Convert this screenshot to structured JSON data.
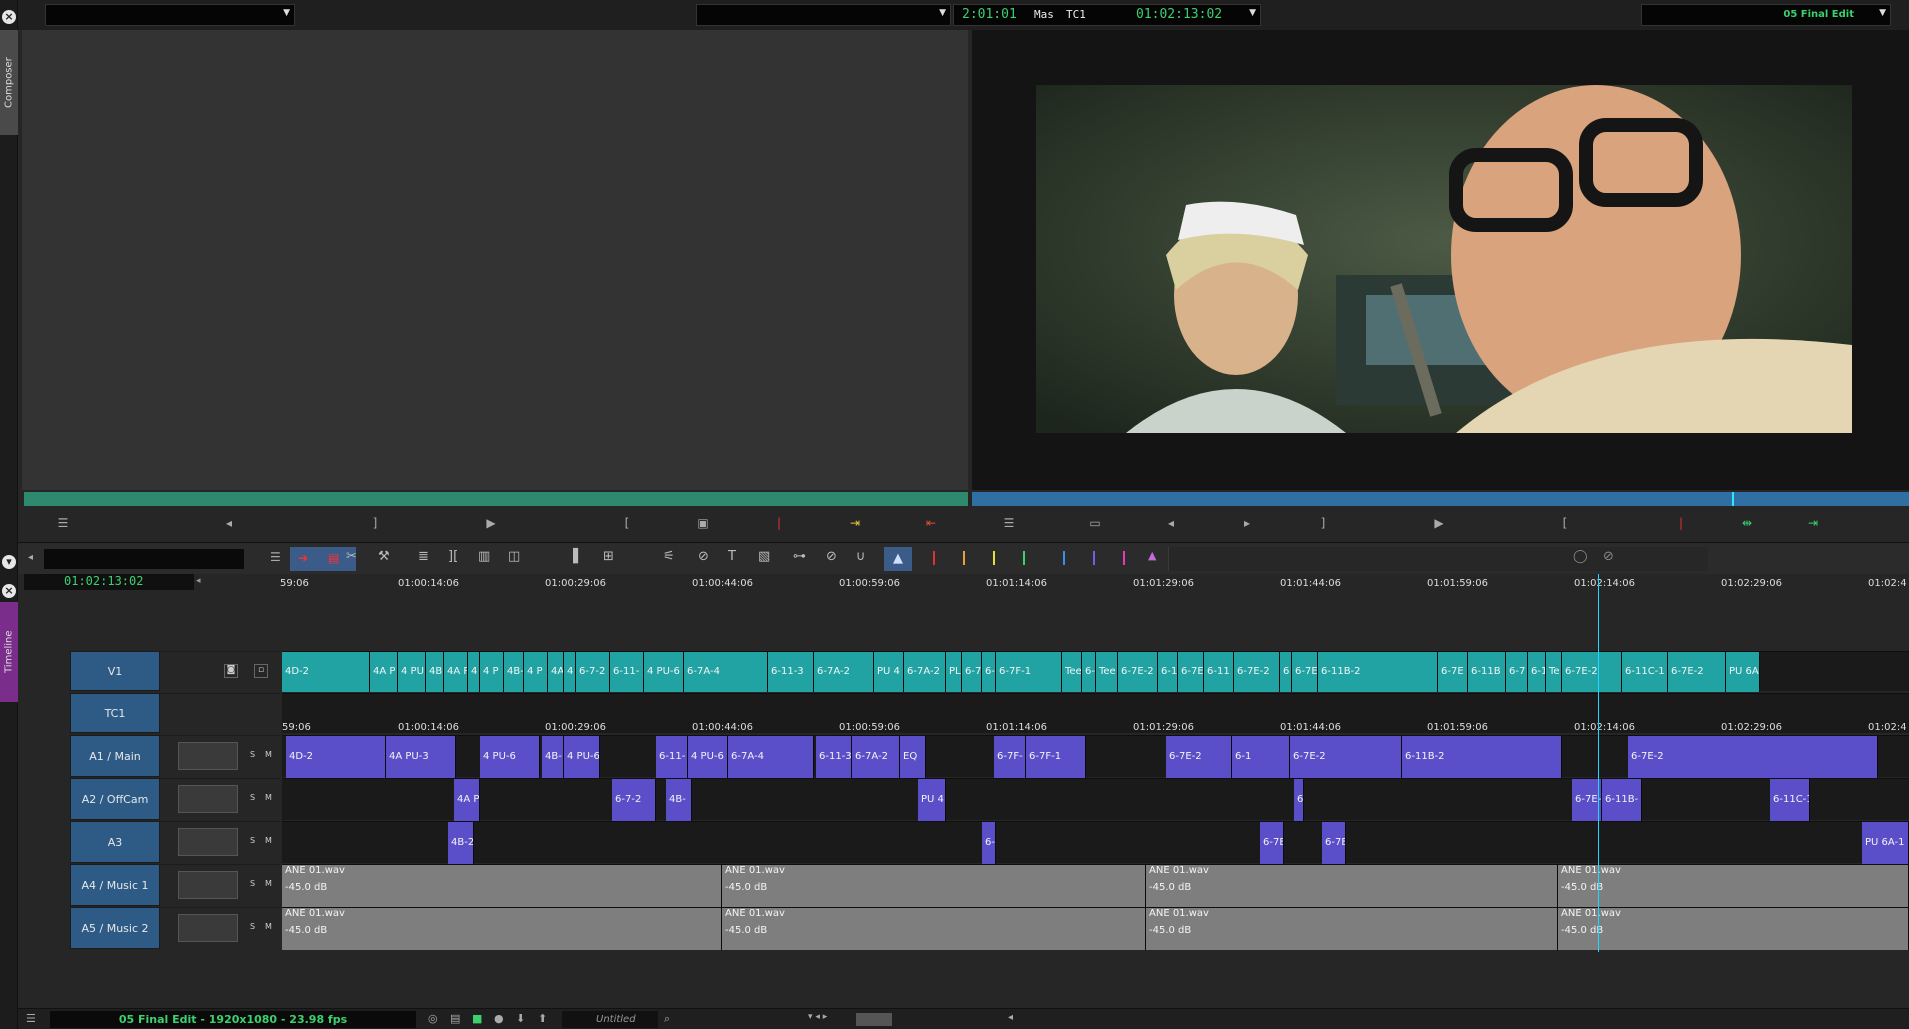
{
  "side": {
    "composer_label": "Composer",
    "timeline_label": "Timeline"
  },
  "topbar": {
    "source_dropdown_value": "",
    "record_dropdown_value": "",
    "duration_tc": "2:01:01",
    "track_label": "Mas",
    "tc_label": "TC1",
    "record_tc": "01:02:13:02",
    "sequence_name": "05 Final Edit"
  },
  "timeline": {
    "current_tc": "01:02:13:02",
    "ruler_ticks": [
      "59:06",
      "01:00:14:06",
      "01:00:29:06",
      "01:00:44:06",
      "01:00:59:06",
      "01:01:14:06",
      "01:01:29:06",
      "01:01:44:06",
      "01:01:59:06",
      "01:02:14:06",
      "01:02:29:06",
      "01:02:4"
    ],
    "tracks": [
      {
        "name": "V1"
      },
      {
        "name": "TC1"
      },
      {
        "name": "A1 / Main"
      },
      {
        "name": "A2 / OffCam"
      },
      {
        "name": "A3"
      },
      {
        "name": "A4 / Music 1"
      },
      {
        "name": "A5 / Music 2"
      }
    ],
    "v1_clips": [
      "4D-2",
      "4A P",
      "4 PU",
      "4B",
      "4A P",
      "4",
      "4 P",
      "4B-",
      "4 P",
      "4A",
      "4",
      "6-7-2",
      "6-11-",
      "4 PU-6",
      "6-7A-4",
      "6-11-3",
      "6-7A-2",
      "PU 4",
      "6-7A-2",
      "PL",
      "6-7",
      "6-1",
      "6-7F-1",
      "Tee",
      "6-",
      "Tee",
      "6-7E-2",
      "6-1",
      "6-7E",
      "6-11",
      "6-7E-2",
      "6",
      "6-7E",
      "6-11B-2",
      "6-7E",
      "6-11B",
      "6-7",
      "6-1",
      "Te",
      "6-7E-2",
      "6-11C-1",
      "6-7E-2",
      "PU 6A"
    ],
    "a1_clips": [
      "4D-2",
      "4A PU-3",
      "4 PU-6",
      "4B-",
      "4 PU-6",
      "6-11-",
      "4 PU-6",
      "6-7A-4",
      "6-11-3",
      "6-7A-2",
      "EQ",
      "6-7F-",
      "6-7F-1",
      "6-7E-2",
      "6-1",
      "6-7E-2",
      "6-11B-2",
      "6-7E-2"
    ],
    "a2_clips": [
      "4A P",
      "6-7-2",
      "4B-",
      "PU 4",
      "6-",
      "6-7E-2",
      "6-11B-",
      "6-11C-1"
    ],
    "a3_clips": [
      "4B-2",
      "6-",
      "6-7E",
      "6-7E",
      "PU 6A-1"
    ],
    "music_clip_name": "ANE 01.wav",
    "music_level": "-45.0 dB",
    "solo_label": "S",
    "mute_label": "M"
  },
  "bottombar": {
    "sequence_info": "05 Final Edit - 1920x1080 - 23.98 fps",
    "bin_name": "Untitled"
  }
}
